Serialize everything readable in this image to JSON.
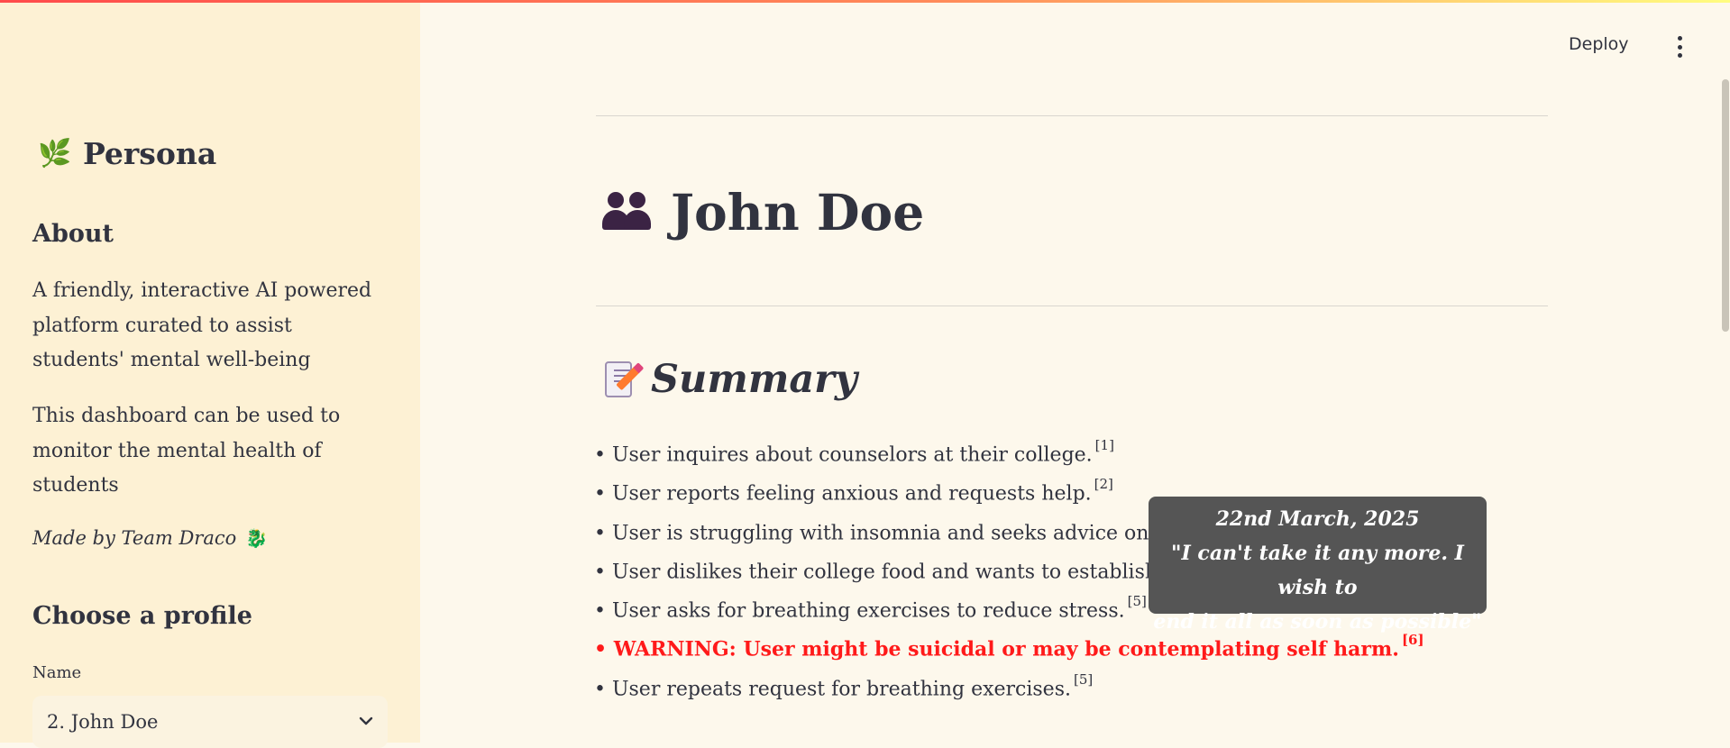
{
  "sidebar": {
    "brand_icon": "🌿",
    "brand_title": "Persona",
    "about_heading": "About",
    "about_p1": "A friendly, interactive AI powered platform curated to assist students' mental well-being",
    "about_p2": "This dashboard can be used to monitor the mental health of students",
    "made_by": "Made by Team Draco",
    "made_by_icon": "dragon-icon",
    "choose_heading": "Choose a profile",
    "name_label": "Name",
    "selected_profile": "2. John Doe"
  },
  "header": {
    "deploy_label": "Deploy",
    "menu_icon": "kebab-menu-icon"
  },
  "main": {
    "title": "John Doe",
    "title_icon": "people-icon",
    "summary_heading": "Summary",
    "summary_icon": "memo-icon",
    "bullets": [
      {
        "text": "• User inquires about counselors at their college.",
        "ref": "[1]"
      },
      {
        "text": "• User reports feeling anxious and requests help.",
        "ref": "[2]"
      },
      {
        "text": "• User is struggling with insomnia and seeks advice on ho",
        "ref": ""
      },
      {
        "text": "• User dislikes their college food and wants to establish a h",
        "ref": ""
      },
      {
        "text": "• User asks for breathing exercises to reduce stress.",
        "ref": "[5]"
      },
      {
        "text": "• WARNING: User might be suicidal or may be contemplating self harm.",
        "ref": "[6]"
      },
      {
        "text": "• User repeats request for breathing exercises.",
        "ref": "[5]"
      }
    ],
    "tooltip": {
      "date": "22nd March, 2025",
      "line1": "\"I can't take it any more. I wish to",
      "line2": "end it all as soon as possible\""
    }
  },
  "colors": {
    "accent_gradient_start": "#ff4b4b",
    "accent_gradient_end": "#fffd80",
    "sidebar_bg": "#fdf1d4",
    "main_bg": "#fdf8ec",
    "warning": "#ff1a1a",
    "tooltip_bg": "#555555"
  }
}
